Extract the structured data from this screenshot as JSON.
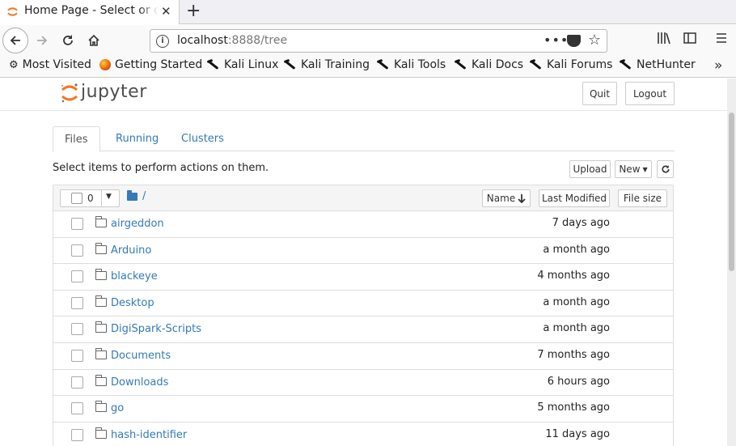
{
  "browser": {
    "tab_title": "Home Page - Select or create a notebook",
    "url_host": "localhost",
    "url_rest": ":8888/tree",
    "bookmarks": [
      "Most Visited",
      "Getting Started",
      "Kali Linux",
      "Kali Training",
      "Kali Tools",
      "Kali Docs",
      "Kali Forums",
      "NetHunter"
    ]
  },
  "header": {
    "logo_text": "jupyter",
    "quit_label": "Quit",
    "logout_label": "Logout"
  },
  "tabs": [
    "Files",
    "Running",
    "Clusters"
  ],
  "toolbar": {
    "message": "Select items to perform actions on them.",
    "upload_label": "Upload",
    "new_label": "New"
  },
  "list_header": {
    "selected_count": "0",
    "breadcrumb": "/",
    "sort_name": "Name",
    "sort_modified": "Last Modified",
    "sort_size": "File size"
  },
  "files": [
    {
      "name": "airgeddon",
      "modified": "7 days ago"
    },
    {
      "name": "Arduino",
      "modified": "a month ago"
    },
    {
      "name": "blackeye",
      "modified": "4 months ago"
    },
    {
      "name": "Desktop",
      "modified": "a month ago"
    },
    {
      "name": "DigiSpark-Scripts",
      "modified": "a month ago"
    },
    {
      "name": "Documents",
      "modified": "7 months ago"
    },
    {
      "name": "Downloads",
      "modified": "6 hours ago"
    },
    {
      "name": "go",
      "modified": "5 months ago"
    },
    {
      "name": "hash-identifier",
      "modified": "11 days ago"
    }
  ],
  "colors": {
    "link": "#337ab7",
    "jupyter_orange": "#f37726"
  }
}
